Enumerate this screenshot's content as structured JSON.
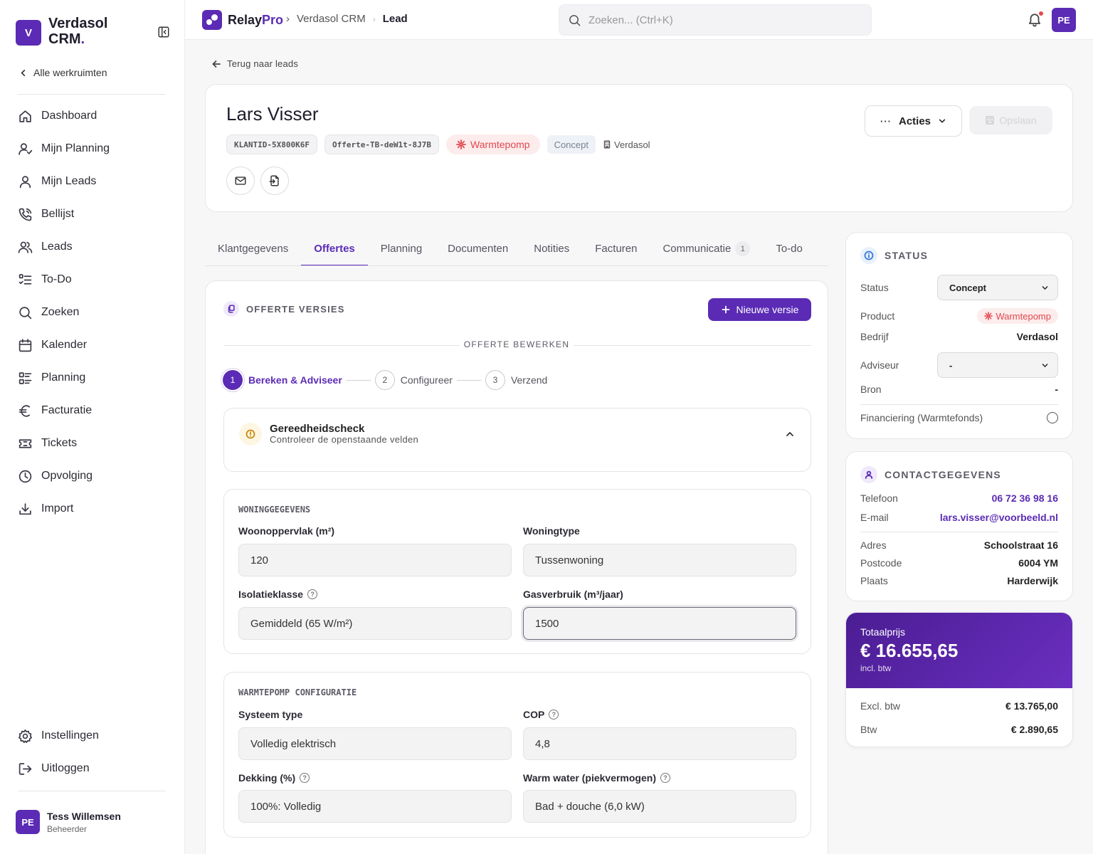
{
  "sidebar": {
    "workspace_initial": "V",
    "workspace_name_line1": "Verdasol",
    "workspace_name_line2": "CRM",
    "workspace_name_dot": ".",
    "back_label": "Alle werkruimten",
    "nav": [
      {
        "label": "Dashboard",
        "icon": "home-icon"
      },
      {
        "label": "Mijn Planning",
        "icon": "user-check-icon"
      },
      {
        "label": "Mijn Leads",
        "icon": "user-icon"
      },
      {
        "label": "Bellijst",
        "icon": "phone-icon"
      },
      {
        "label": "Leads",
        "icon": "users-icon"
      },
      {
        "label": "To-Do",
        "icon": "list-todo-icon"
      },
      {
        "label": "Zoeken",
        "icon": "search-icon"
      },
      {
        "label": "Kalender",
        "icon": "calendar-icon"
      },
      {
        "label": "Planning",
        "icon": "planning-list-icon"
      },
      {
        "label": "Facturatie",
        "icon": "euro-icon"
      },
      {
        "label": "Tickets",
        "icon": "ticket-icon"
      },
      {
        "label": "Opvolging",
        "icon": "clock-icon"
      },
      {
        "label": "Import",
        "icon": "download-icon"
      }
    ],
    "bottom_nav": [
      {
        "label": "Instellingen",
        "icon": "gear-icon"
      },
      {
        "label": "Uitloggen",
        "icon": "logout-icon"
      }
    ],
    "user": {
      "initials": "PE",
      "name": "Tess Willemsen",
      "role": "Beheerder"
    }
  },
  "topbar": {
    "brand_relay": "Relay",
    "brand_pro": "Pro",
    "breadcrumbs": [
      "Verdasol CRM",
      "Lead"
    ],
    "search_placeholder": "Zoeken... (Ctrl+K)",
    "avatar_initials": "PE"
  },
  "lead": {
    "back_label": "Terug naar leads",
    "name": "Lars Visser",
    "customer_id": "KLANTID-5X800K6F",
    "offer_id": "Offerte-TB-deW1t-8J7B",
    "product": "Warmtepomp",
    "status": "Concept",
    "company": "Verdasol",
    "actions_label": "Acties",
    "save_label": "Opslaan"
  },
  "tabs": [
    {
      "label": "Klantgegevens",
      "active": false
    },
    {
      "label": "Offertes",
      "active": true
    },
    {
      "label": "Planning",
      "active": false
    },
    {
      "label": "Documenten",
      "active": false
    },
    {
      "label": "Notities",
      "active": false
    },
    {
      "label": "Facturen",
      "active": false
    },
    {
      "label": "Communicatie",
      "active": false,
      "badge": "1"
    },
    {
      "label": "To-do",
      "active": false
    }
  ],
  "offer": {
    "versions_title": "OFFERTE VERSIES",
    "new_version_label": "Nieuwe versie",
    "edit_label": "OFFERTE BEWERKEN",
    "steps": [
      {
        "num": "1",
        "label": "Bereken & Adviseer",
        "active": true
      },
      {
        "num": "2",
        "label": "Configureer",
        "active": false
      },
      {
        "num": "3",
        "label": "Verzend",
        "active": false
      }
    ],
    "check_title": "Gereedheidscheck",
    "check_sub": "Controleer de openstaande velden",
    "housing": {
      "title": "WONINGGEGEVENS",
      "area_label": "Woonoppervlak (m²)",
      "area_value": "120",
      "type_label": "Woningtype",
      "type_value": "Tussenwoning",
      "insulation_label": "Isolatieklasse",
      "insulation_value": "Gemiddeld (65 W/m²)",
      "gas_label": "Gasverbruik (m³/jaar)",
      "gas_value": "1500"
    },
    "heatpump": {
      "title": "WARMTEPOMP CONFIGURATIE",
      "system_label": "Systeem type",
      "system_value": "Volledig elektrisch",
      "cop_label": "COP",
      "cop_value": "4,8",
      "coverage_label": "Dekking (%)",
      "coverage_value": "100%: Volledig",
      "water_label": "Warm water (piekvermogen)",
      "water_value": "Bad + douche (6,0 kW)"
    }
  },
  "status_card": {
    "title": "STATUS",
    "status_label": "Status",
    "status_value": "Concept",
    "product_label": "Product",
    "product_value": "Warmtepomp",
    "company_label": "Bedrijf",
    "company_value": "Verdasol",
    "advisor_label": "Adviseur",
    "advisor_value": "-",
    "source_label": "Bron",
    "source_value": "-",
    "financing_label": "Financiering (Warmtefonds)"
  },
  "contact_card": {
    "title": "CONTACTGEGEVENS",
    "phone_label": "Telefoon",
    "phone_value": "06 72 36 98 16",
    "email_label": "E-mail",
    "email_value": "lars.visser@voorbeeld.nl",
    "address_label": "Adres",
    "address_value": "Schoolstraat 16",
    "postcode_label": "Postcode",
    "postcode_value": "6004 YM",
    "city_label": "Plaats",
    "city_value": "Harderwijk"
  },
  "total_card": {
    "label": "Totaalprijs",
    "price": "€ 16.655,65",
    "incl": "incl. btw",
    "excl_label": "Excl. btw",
    "excl_value": "€ 13.765,00",
    "vat_label": "Btw",
    "vat_value": "€ 2.890,65"
  },
  "colors": {
    "accent": "#5b2bb5",
    "danger": "#e0484f",
    "background": "#f7f7f8"
  }
}
